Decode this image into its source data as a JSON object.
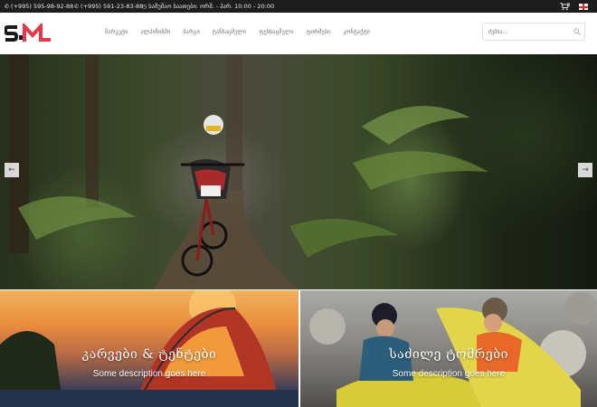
{
  "topbar": {
    "phone1": "(+995) 595-98-92-88",
    "phone2": "(+995) 591-23-83-88",
    "hours": "სამუშაო საათები: ორშ. - პარ. 10:00 - 20:00",
    "cart_count": "0"
  },
  "header": {
    "logo_text": "SM",
    "nav": [
      "მარკეტი",
      "ალპინიზმი",
      "ბარგი",
      "ტანსაცმელი",
      "ფეხსაცმელი",
      "ფირმები",
      "კონტაქტი"
    ],
    "search_placeholder": "ძებნა..."
  },
  "slider": {
    "prev_label": "←",
    "next_label": "→"
  },
  "banners": [
    {
      "title": "კარვები & ტენტები",
      "description": "Some description goes here"
    },
    {
      "title": "საძილე ტომრები",
      "description": "Some description goes here"
    }
  ],
  "colors": {
    "topbar_bg": "#1d1d1d",
    "brand_red": "#e9384a"
  }
}
